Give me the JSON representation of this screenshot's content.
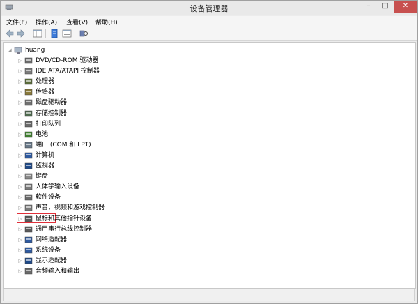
{
  "window": {
    "title": "设备管理器",
    "min": "–",
    "max": "□",
    "close": "✕"
  },
  "menu": [
    "文件(F)",
    "操作(A)",
    "查看(V)",
    "帮助(H)"
  ],
  "toolbar": [
    {
      "name": "back-arrow-icon",
      "icon": "◀"
    },
    {
      "name": "forward-arrow-icon",
      "icon": "▶"
    },
    {
      "name": "show-hide-console-tree-icon",
      "icon": ""
    },
    {
      "name": "properties-icon",
      "icon": ""
    },
    {
      "name": "help-icon",
      "icon": ""
    },
    {
      "name": "scan-hardware-icon",
      "icon": ""
    }
  ],
  "tree": {
    "root": "huang",
    "devices": [
      {
        "label": "DVD/CD-ROM 驱动器",
        "icon": "dvd-drive-icon",
        "color": "#6b6b6b"
      },
      {
        "label": "IDE ATA/ATAPI 控制器",
        "icon": "ide-controller-icon",
        "color": "#7c7c7c"
      },
      {
        "label": "处理器",
        "icon": "processor-icon",
        "color": "#5a6b3a"
      },
      {
        "label": "传感器",
        "icon": "sensor-icon",
        "color": "#8a7a3a"
      },
      {
        "label": "磁盘驱动器",
        "icon": "disk-drive-icon",
        "color": "#707070"
      },
      {
        "label": "存储控制器",
        "icon": "storage-controller-icon",
        "color": "#4e6a4e"
      },
      {
        "label": "打印队列",
        "icon": "print-queue-icon",
        "color": "#6a6a6a"
      },
      {
        "label": "电池",
        "icon": "battery-icon",
        "color": "#3f7f2f"
      },
      {
        "label": "端口 (COM 和 LPT)",
        "icon": "port-icon",
        "color": "#6a7a8a"
      },
      {
        "label": "计算机",
        "icon": "computer-icon",
        "color": "#2e5aa0"
      },
      {
        "label": "监视器",
        "icon": "monitor-icon",
        "color": "#1e4a8a"
      },
      {
        "label": "键盘",
        "icon": "keyboard-icon",
        "color": "#8a8a8a"
      },
      {
        "label": "人体学输入设备",
        "icon": "hid-icon",
        "color": "#7a7a7a"
      },
      {
        "label": "软件设备",
        "icon": "software-device-icon",
        "color": "#6a6a6a"
      },
      {
        "label": "声音、视频和游戏控制器",
        "icon": "sound-icon",
        "color": "#7a7a7a"
      },
      {
        "label": "鼠标和其他指针设备",
        "icon": "mouse-icon",
        "color": "#5a5a5a"
      },
      {
        "label": "通用串行总线控制器",
        "icon": "usb-icon",
        "color": "#5a5a5a"
      },
      {
        "label": "网络适配器",
        "icon": "network-adapter-icon",
        "color": "#2e5aa0"
      },
      {
        "label": "系统设备",
        "icon": "system-device-icon",
        "color": "#2e5aa0"
      },
      {
        "label": "显示适配器",
        "icon": "display-adapter-icon",
        "color": "#1e4a8a"
      },
      {
        "label": "音频输入和输出",
        "icon": "audio-io-icon",
        "color": "#6a6a6a"
      }
    ]
  }
}
